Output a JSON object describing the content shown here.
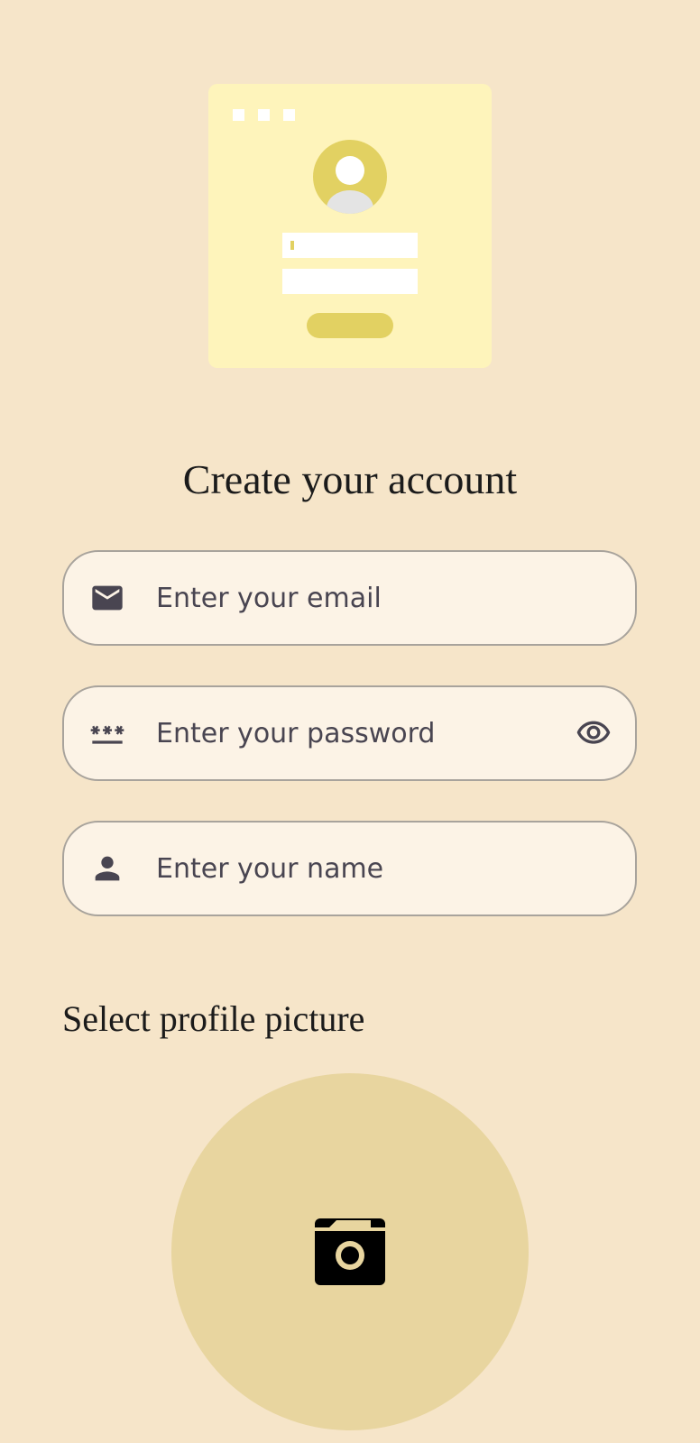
{
  "heading": {
    "title": "Create your account"
  },
  "form": {
    "email": {
      "placeholder": "Enter your email",
      "value": "",
      "icon": "email-icon"
    },
    "password": {
      "placeholder": "Enter your password",
      "value": "",
      "icon": "password-icon",
      "trailing_icon": "eye-icon"
    },
    "name": {
      "placeholder": "Enter your name",
      "value": "",
      "icon": "person-icon"
    }
  },
  "profile_picture": {
    "label": "Select profile picture",
    "icon": "camera-icon"
  },
  "colors": {
    "background": "#F6E5C9",
    "field_background": "#FCF3E6",
    "field_border": "#A8A39C",
    "accent": "#E2D162",
    "picker_background": "#E8D59F",
    "illustration_background": "#FEF4BB",
    "icon": "#494551"
  }
}
